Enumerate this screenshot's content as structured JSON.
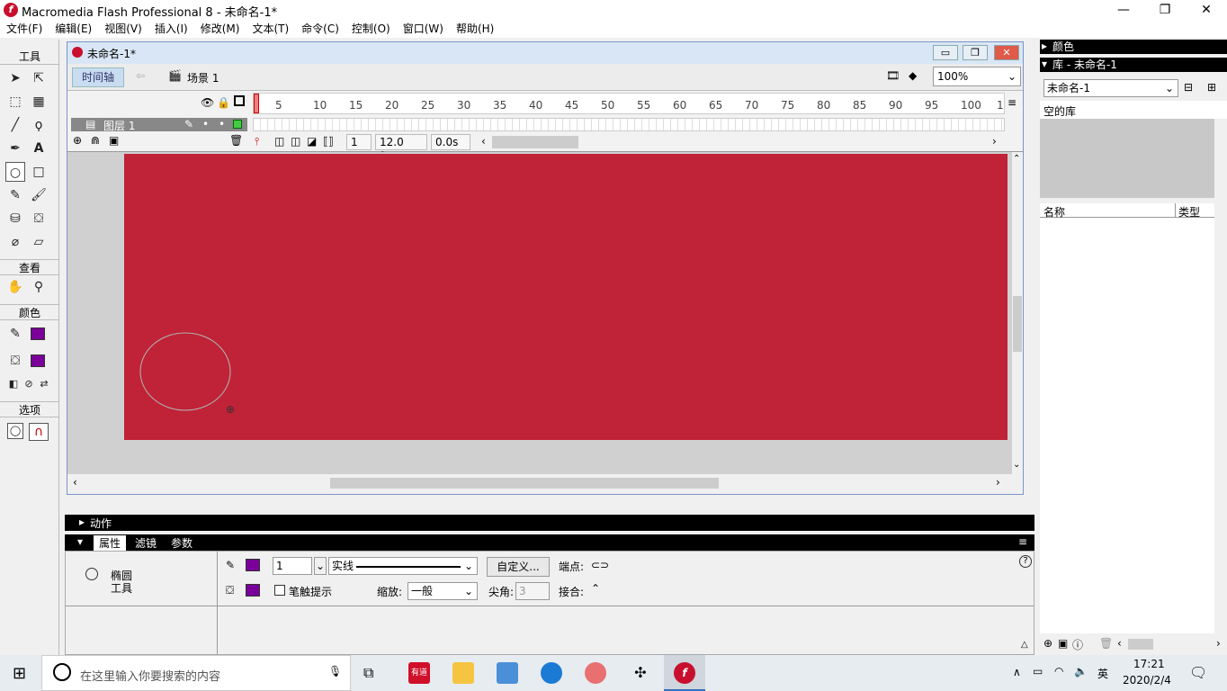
{
  "window": {
    "title": "Macromedia Flash Professional 8 - 未命名-1*",
    "minimize": "—",
    "restore": "❐",
    "close": "✕"
  },
  "menu": [
    "文件(F)",
    "编辑(E)",
    "视图(V)",
    "插入(I)",
    "修改(M)",
    "文本(T)",
    "命令(C)",
    "控制(O)",
    "窗口(W)",
    "帮助(H)"
  ],
  "toolbox": {
    "tools_label": "工具",
    "view_label": "查看",
    "colors_label": "颜色",
    "options_label": "选项"
  },
  "document": {
    "title": "未命名-1*",
    "timeline_btn": "时间轴",
    "scene": "场景 1",
    "zoom": "100%"
  },
  "timeline": {
    "ruler_ticks": [
      "5",
      "10",
      "15",
      "20",
      "25",
      "30",
      "35",
      "40",
      "45",
      "50",
      "55",
      "60",
      "65",
      "70",
      "75",
      "80",
      "85",
      "90",
      "95",
      "100",
      "1"
    ],
    "layer_name": "图层 1",
    "current_frame": "1",
    "fps": "12.0 fps",
    "time": "0.0s"
  },
  "colors": {
    "stage": "#c02238",
    "fill_swatch": "#7a0099"
  },
  "panels": {
    "action_title": "动作",
    "props_tabs": [
      "属性",
      "滤镜",
      "参数"
    ],
    "tool_name": "椭圆",
    "tool_sub": "工具",
    "stroke_height": "1",
    "stroke_style": "实线",
    "custom_btn": "自定义...",
    "cap_label": "端点:",
    "stroke_hint": "笔触提示",
    "scale_label": "缩放:",
    "scale_value": "一般",
    "miter_label": "尖角:",
    "miter_value": "3",
    "join_label": "接合:"
  },
  "right_panel": {
    "colors_title": "颜色",
    "library_title": "库 - 未命名-1",
    "library_select": "未命名-1",
    "empty_library": "空的库",
    "col_name": "名称",
    "col_type": "类型"
  },
  "taskbar": {
    "search_placeholder": "在这里输入你要搜索的内容",
    "ime": "英",
    "time": "17:21",
    "date": "2020/2/4"
  }
}
